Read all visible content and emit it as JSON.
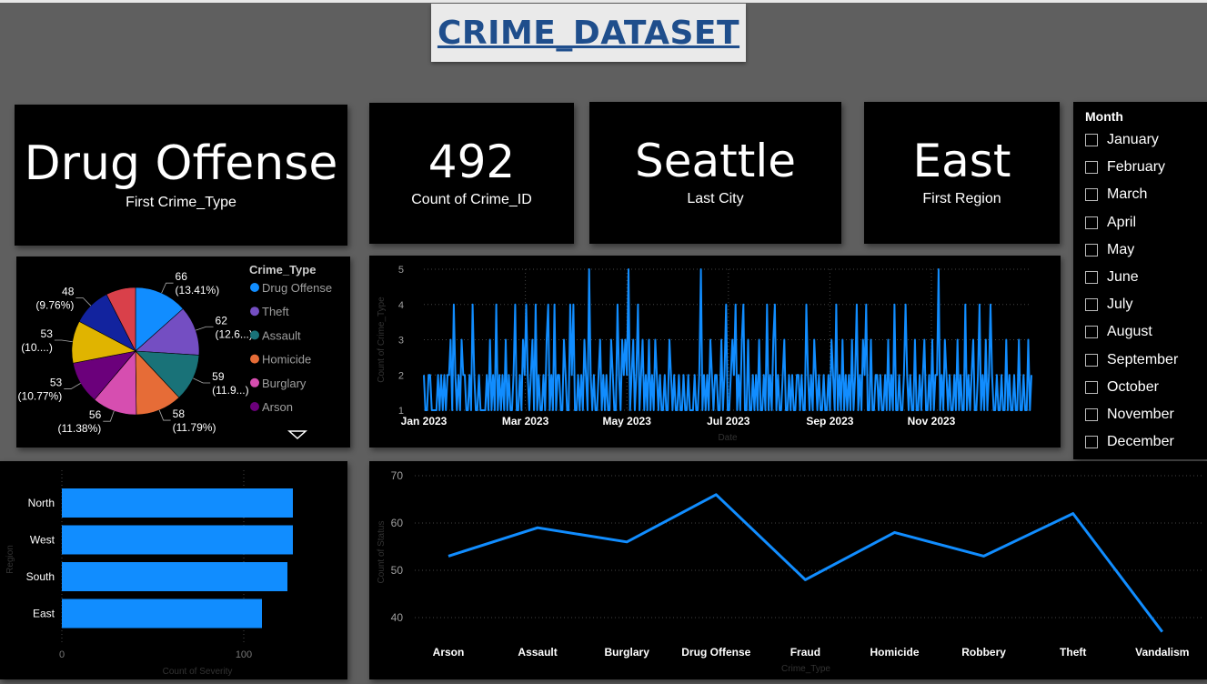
{
  "title": "CRIME_DATASET",
  "cards": [
    {
      "value": "Drug Offense",
      "label": "First Crime_Type"
    },
    {
      "value": "492",
      "label": "Count of Crime_ID"
    },
    {
      "value": "Seattle",
      "label": "Last City"
    },
    {
      "value": "East",
      "label": "First Region"
    }
  ],
  "slicer": {
    "title": "Month",
    "items": [
      "January",
      "February",
      "March",
      "April",
      "May",
      "June",
      "July",
      "August",
      "September",
      "October",
      "November",
      "December"
    ]
  },
  "colors": {
    "accent": "#118dff",
    "background": "#5f5f5f",
    "panel": "#000000",
    "title_text": "#1f4e8c",
    "title_box": "#eaeaea"
  },
  "chart_data": [
    {
      "type": "pie",
      "legend_title": "Crime_Type",
      "legend_placement": "right",
      "legend_more_icon": "triangle-down-icon",
      "slices": [
        {
          "name": "Drug Offense",
          "value": 66,
          "label": "66",
          "pct": "(13.41%)",
          "color": "#118dff"
        },
        {
          "name": "Theft",
          "value": 62,
          "label": "62",
          "pct": "(12.6...)",
          "color": "#744ec2"
        },
        {
          "name": "Assault",
          "value": 59,
          "label": "59",
          "pct": "(11.9...)",
          "color": "#197278"
        },
        {
          "name": "Homicide",
          "value": 58,
          "label": "58",
          "pct": "(11.79%)",
          "color": "#e66c37"
        },
        {
          "name": "Burglary",
          "value": 56,
          "label": "56",
          "pct": "(11.38%)",
          "color": "#d64eb0"
        },
        {
          "name": "Arson",
          "value": 53,
          "label": "53",
          "pct": "(10.77%)",
          "color": "#6b007b"
        },
        {
          "name": "",
          "value": 53,
          "label": "53",
          "pct": "(10....)",
          "color": "#e0b400"
        },
        {
          "name": "",
          "value": 48,
          "label": "48",
          "pct": "(9.76%)",
          "color": "#12239e"
        },
        {
          "name": "",
          "value": 37,
          "label": "",
          "pct": "",
          "color": "#d9404a"
        }
      ],
      "legend": [
        "Drug Offense",
        "Theft",
        "Assault",
        "Homicide",
        "Burglary",
        "Arson"
      ]
    },
    {
      "type": "line",
      "xlabel": "Date",
      "ylabel": "Count of Crime_Type",
      "x_ticks": [
        "Jan 2023",
        "Mar 2023",
        "May 2023",
        "Jul 2023",
        "Sep 2023",
        "Nov 2023"
      ],
      "x_range": [
        "2023-01-01",
        "2023-12-31"
      ],
      "ylim": [
        1,
        5
      ],
      "y_ticks": [
        1,
        2,
        3,
        4,
        5
      ],
      "grid": true,
      "series": [
        {
          "values": [
            2,
            1,
            1,
            2,
            2,
            1,
            1,
            1,
            1,
            2,
            1,
            2,
            1,
            2,
            1,
            2,
            2,
            3,
            1,
            4,
            2,
            1,
            2,
            1,
            3,
            2,
            2,
            1,
            1,
            2,
            1,
            4,
            2,
            1,
            1,
            2,
            1,
            1,
            1,
            1,
            2,
            1,
            3,
            1,
            2,
            1,
            4,
            1,
            2,
            1,
            2,
            1,
            3,
            1,
            2,
            1,
            1,
            2,
            4,
            1,
            1,
            2,
            1,
            3,
            2,
            4,
            2,
            1,
            2,
            3,
            1,
            4,
            1,
            2,
            1,
            1,
            2,
            1,
            3,
            4,
            1,
            2,
            1,
            4,
            1,
            2,
            2,
            1,
            1,
            3,
            2,
            1,
            1,
            4,
            2,
            4,
            1,
            1,
            2,
            1,
            2,
            1,
            3,
            2,
            1,
            5,
            2,
            1,
            2,
            1,
            1,
            2,
            3,
            1,
            2,
            1,
            2,
            1,
            1,
            3,
            2,
            1,
            1,
            4,
            2,
            1,
            3,
            2,
            3,
            2,
            5,
            1,
            2,
            3,
            1,
            2,
            4,
            1,
            2,
            3,
            1,
            2,
            1,
            3,
            1,
            2,
            1,
            3,
            2,
            1,
            2,
            1,
            1,
            2,
            1,
            1,
            3,
            2,
            1,
            2,
            1,
            1,
            2,
            1,
            1,
            2,
            1,
            1,
            2,
            1,
            1,
            1,
            2,
            1,
            1,
            2,
            5,
            1,
            2,
            1,
            2,
            1,
            3,
            2,
            1,
            2,
            2,
            1,
            1,
            3,
            1,
            2,
            4,
            1,
            1,
            2,
            3,
            2,
            4,
            1,
            2,
            1,
            3,
            4,
            1,
            1,
            3,
            1,
            1,
            2,
            1,
            2,
            1,
            3,
            1,
            1,
            2,
            1,
            4,
            1,
            2,
            1,
            3,
            4,
            1,
            2,
            1,
            1,
            2,
            3,
            1,
            1,
            2,
            1,
            2,
            1,
            1,
            2,
            2,
            1,
            2,
            1,
            1,
            4,
            2,
            1,
            2,
            1,
            3,
            2,
            1,
            2,
            1,
            1,
            2,
            1,
            1,
            2,
            1,
            3,
            2,
            1,
            4,
            1,
            2,
            1,
            3,
            1,
            2,
            1,
            2,
            1,
            3,
            1,
            2,
            4,
            1,
            2,
            1,
            3,
            2,
            4,
            1,
            1,
            3,
            1,
            1,
            2,
            2,
            1,
            2,
            1,
            1,
            2,
            1,
            3,
            1,
            2,
            1,
            4,
            1,
            1,
            2,
            1,
            1,
            2,
            4,
            2,
            1,
            2,
            1,
            1,
            3,
            1,
            1,
            2,
            1,
            2,
            3,
            1,
            1,
            2,
            1,
            3,
            1,
            2,
            2,
            5,
            1,
            2,
            1,
            3,
            2,
            1,
            2,
            1,
            1,
            2,
            1,
            3,
            1,
            2,
            1,
            1,
            4,
            1,
            2,
            1,
            2,
            3,
            1,
            1,
            2,
            4,
            1,
            2,
            1,
            3,
            1,
            2,
            4,
            2,
            1,
            1,
            2,
            1,
            1,
            2,
            1,
            1,
            3,
            1,
            2,
            1,
            1,
            2,
            1,
            1,
            3,
            1,
            1,
            2,
            1,
            1,
            3,
            1,
            2
          ]
        }
      ]
    },
    {
      "type": "bar",
      "orientation": "horizontal",
      "categories": [
        "North",
        "West",
        "South",
        "East"
      ],
      "values": [
        127,
        127,
        124,
        110
      ],
      "xlabel": "Count of Severity",
      "ylabel": "Region",
      "x_ticks": [
        0,
        100
      ],
      "xlim": [
        0,
        130
      ]
    },
    {
      "type": "line",
      "categories": [
        "Arson",
        "Assault",
        "Burglary",
        "Drug Offense",
        "Fraud",
        "Homicide",
        "Robbery",
        "Theft",
        "Vandalism"
      ],
      "values": [
        53,
        59,
        56,
        66,
        48,
        58,
        53,
        62,
        37
      ],
      "xlabel": "Crime_Type",
      "ylabel": "Count of Status",
      "ylim": [
        36,
        70
      ],
      "y_ticks": [
        40,
        50,
        60,
        70
      ],
      "grid": true
    }
  ]
}
